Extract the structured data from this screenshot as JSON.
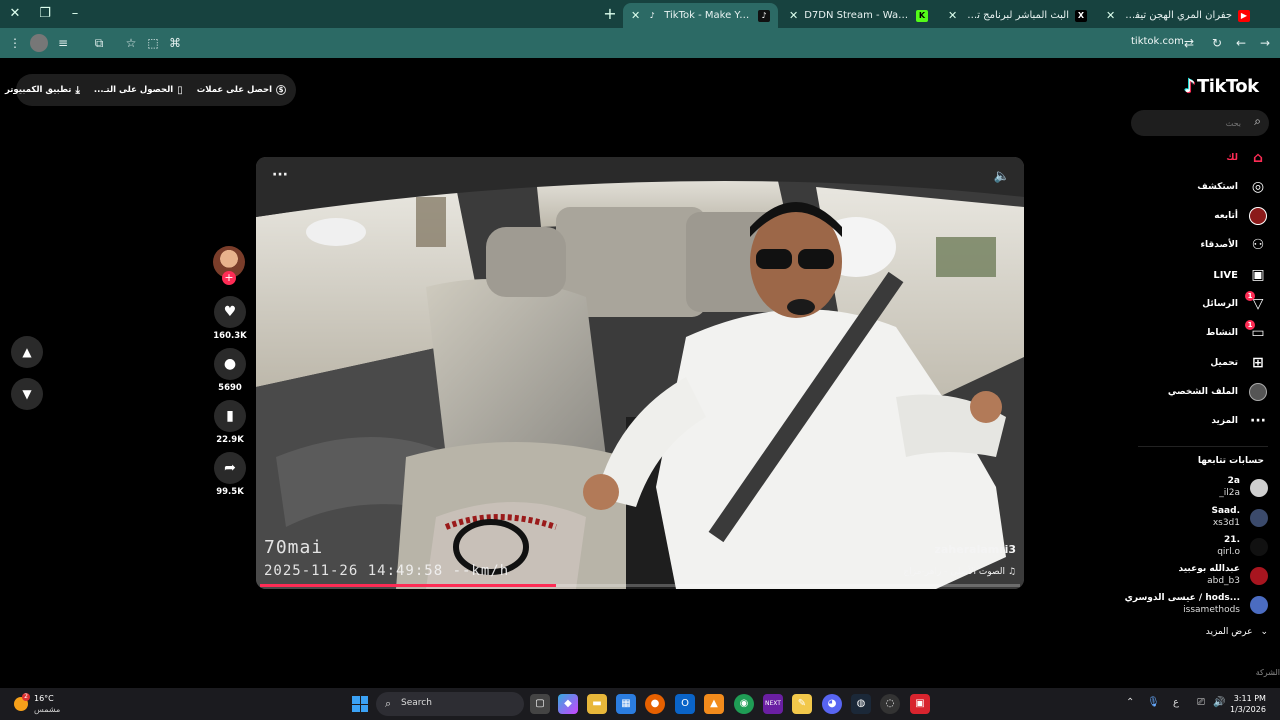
{
  "tabs": [
    {
      "title": "جفران المري الهجن تيفي صبي يا...",
      "favicon": "youtube-icon",
      "active": false
    },
    {
      "title": "البث المباشر لبرنامج تحدي الصياد...",
      "favicon": "x-icon",
      "active": false
    },
    {
      "title": "D7DN Stream - Watch Live on K...",
      "favicon": "kick-icon",
      "active": false
    },
    {
      "title": "TikTok - Make Your Day",
      "favicon": "tiktok-icon",
      "active": true
    }
  ],
  "address_bar": {
    "url": "tiktok.com"
  },
  "topbar": {
    "coins_label": "احصل على عملات",
    "get_app_label": "الحصول على التـ...",
    "desktop_app_label": "تطبيق الكمبيوتر"
  },
  "logo": {
    "text": "TikTok"
  },
  "search": {
    "placeholder": "بحث"
  },
  "nav": [
    {
      "label": "لك",
      "icon": "home-icon",
      "active": true
    },
    {
      "label": "استكشف",
      "icon": "compass-icon"
    },
    {
      "label": "أتابعه",
      "icon": "following-avatar-icon"
    },
    {
      "label": "الأصدقاء",
      "icon": "friends-icon"
    },
    {
      "label": "LIVE",
      "icon": "live-icon"
    },
    {
      "label": "الرسائل",
      "icon": "messages-icon",
      "badge": "1"
    },
    {
      "label": "النشاط",
      "icon": "activity-icon",
      "badge": "1"
    },
    {
      "label": "تحميل",
      "icon": "upload-icon"
    },
    {
      "label": "الملف الشخصي",
      "icon": "profile-avatar-icon"
    },
    {
      "label": "المزيد",
      "icon": "more-icon"
    }
  ],
  "following": {
    "title": "حسابات تتابعها",
    "accounts": [
      {
        "name": "2a",
        "handle": "_il2a",
        "color": "#d0d0d0"
      },
      {
        "name": "Saad.",
        "handle": "xs3d1",
        "color": "#3b4a6b"
      },
      {
        "name": "21.",
        "handle": "qirl.o",
        "color": "#111111"
      },
      {
        "name": "عبدالله بوعبيد",
        "handle": "abd_b3",
        "color": "#a8151f"
      },
      {
        "name": "عيسى الدوسري / hods...",
        "handle": "issamethods",
        "color": "#4b6cc1"
      }
    ],
    "see_more": "عرض المزيد"
  },
  "company": "الشركة",
  "video": {
    "brand": "70mai",
    "timestamp": "2025-11-26 14:49:58 --km/h",
    "author": "zaheralamri3",
    "sound": "الصوت الأصلي - زاهر-مزاج",
    "progress": 0.39
  },
  "actions": {
    "likes": "160.3K",
    "comments": "5690",
    "saves": "22.9K",
    "shares": "99.5K"
  },
  "taskbar": {
    "weather_temp": "16°C",
    "weather_desc": "مشمس",
    "weather_badge": "2",
    "search_label": "Search",
    "time": "3:11 PM",
    "date": "1/3/2026",
    "lang": "ع"
  }
}
